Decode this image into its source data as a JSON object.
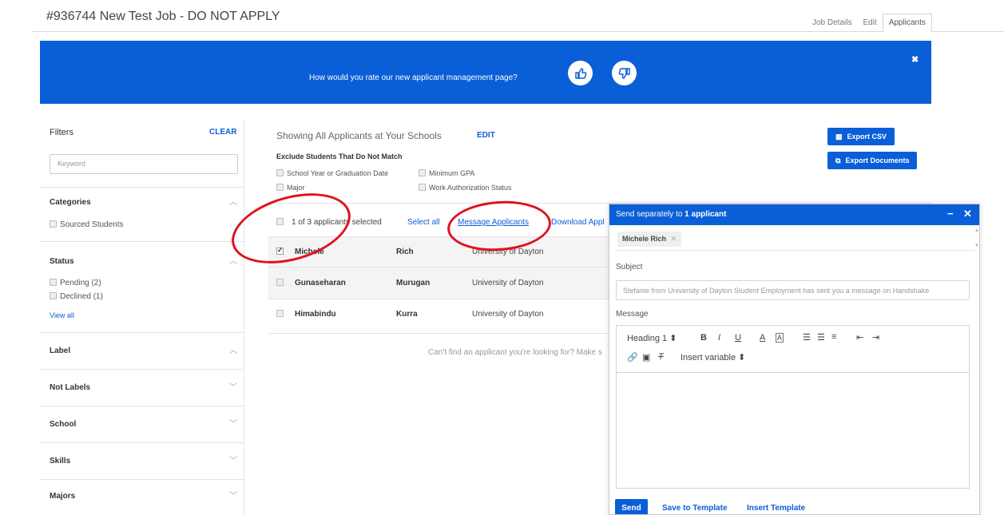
{
  "page": {
    "title": "#936744 New Test Job - DO NOT APPLY",
    "tabs": [
      {
        "label": "Job Details"
      },
      {
        "label": "Edit"
      },
      {
        "label": "Applicants",
        "active": true
      }
    ]
  },
  "banner": {
    "text": "How would you rate our new applicant management page?",
    "thumbs_up_icon": "thumbs-up-icon",
    "thumbs_down_icon": "thumbs-down-icon",
    "close": "✖",
    "color": "#0a5fd8"
  },
  "filters": {
    "title": "Filters",
    "clear": "CLEAR",
    "keyword_placeholder": "Keyword",
    "sections": [
      {
        "label": "Categories",
        "items": [
          "Sourced Students"
        ]
      },
      {
        "label": "Status",
        "items": [
          "Pending (2)",
          "Declined (1)"
        ],
        "view_all": "View all"
      },
      {
        "label": "Label"
      },
      {
        "label": "Not Labels"
      },
      {
        "label": "School"
      },
      {
        "label": "Skills"
      },
      {
        "label": "Majors"
      }
    ]
  },
  "main": {
    "showing": "Showing All Applicants at Your Schools",
    "edit": "EDIT",
    "exclude_title": "Exclude Students That Do Not Match",
    "exclude_options": [
      "School Year or Graduation Date",
      "Minimum GPA",
      "Major",
      "Work Authorization Status"
    ],
    "export_csv": "Export CSV",
    "export_documents": "Export Documents",
    "selection_text": "1 of 3 applicants selected",
    "select_all": "Select all",
    "message_applicants": "Message Applicants",
    "download": "Download Appl",
    "applicants": [
      {
        "first": "Michele",
        "last": "Rich",
        "school": "University of Dayton",
        "checked": true
      },
      {
        "first": "Gunaseharan",
        "last": "Murugan",
        "school": "University of Dayton",
        "checked": false
      },
      {
        "first": "Himabindu",
        "last": "Kurra",
        "school": "University of Dayton",
        "checked": false
      }
    ],
    "cant_find": "Can't find an applicant you're looking for? Make s"
  },
  "modal": {
    "header_prefix": "Send separately to ",
    "header_count": "1 applicant",
    "minimize": "−",
    "close": "✕",
    "recipient": "Michele Rich",
    "recipient_remove": "✕",
    "subject_label": "Subject",
    "subject_value": "Stefanie from University of Dayton Student Employment has sent you a message on Handshake",
    "message_label": "Message",
    "toolbar": {
      "heading": "Heading 1",
      "bold": "B",
      "italic": "I",
      "underline": "U",
      "font_color": "A",
      "bg_color": "A",
      "insert_variable": "Insert variable"
    },
    "send": "Send",
    "save_template": "Save to Template",
    "insert_template": "Insert Template"
  },
  "colors": {
    "accent": "#0a5fd8",
    "annotation": "#e1121f"
  }
}
